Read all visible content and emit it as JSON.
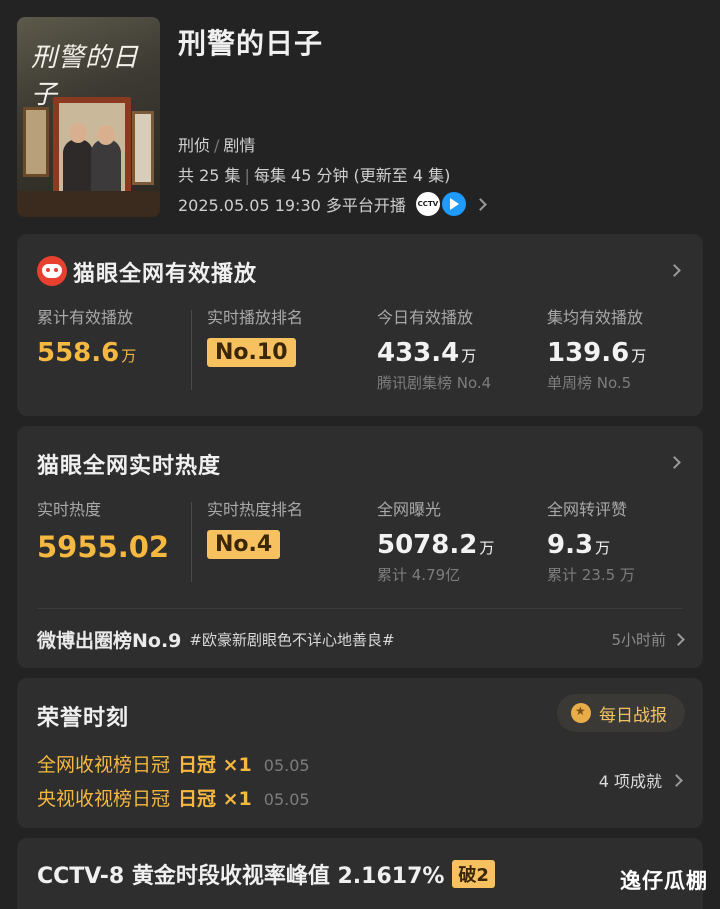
{
  "show": {
    "poster_text": "刑警的日子",
    "title": "刑警的日子",
    "genres": [
      "刑侦",
      "剧情"
    ],
    "episodes_info": "共 25 集 | 每集 45 分钟 (更新至 4 集)",
    "episodes_total": "共 25 集",
    "episode_length": "每集 45 分钟 (更新至 4 集)",
    "premiere": "2025.05.05 19:30 多平台开播",
    "platforms": [
      "CCTV",
      "tencent-video-icon"
    ]
  },
  "effective_play": {
    "title": "猫眼全网有效播放",
    "stats": [
      {
        "label": "累计有效播放",
        "value": "558.6",
        "unit": "万"
      },
      {
        "label": "实时播放排名",
        "badge": "No.10"
      },
      {
        "label": "今日有效播放",
        "value": "433.4",
        "unit": "万",
        "sub": "腾讯剧集榜 No.4"
      },
      {
        "label": "集均有效播放",
        "value": "139.6",
        "unit": "万",
        "sub": "单周榜 No.5"
      }
    ]
  },
  "realtime_heat": {
    "title": "猫眼全网实时热度",
    "stats": [
      {
        "label": "实时热度",
        "value": "5955.02"
      },
      {
        "label": "实时热度排名",
        "badge": "No.4"
      },
      {
        "label": "全网曝光",
        "value": "5078.2",
        "unit": "万",
        "sub": "累计 4.79亿"
      },
      {
        "label": "全网转评赞",
        "value": "9.3",
        "unit": "万",
        "sub": "累计 23.5 万"
      }
    ],
    "weibo": {
      "main": "微博出圈榜No.9",
      "tag": "#欧豪新剧眼色不详心地善良#",
      "time": "5小时前"
    }
  },
  "honors": {
    "title": "荣誉时刻",
    "report_button": "每日战报",
    "items": [
      {
        "name": "全网收视榜日冠",
        "crown": "日冠 ×1",
        "date": "05.05"
      },
      {
        "name": "央视收视榜日冠",
        "crown": "日冠 ×1",
        "date": "05.05"
      }
    ],
    "achievements": "4 项成就"
  },
  "cctv_peak": {
    "text": "CCTV-8 黄金时段收视率峰值 2.1617%",
    "badge": "破2"
  },
  "watermark": "逸仔瓜棚"
}
